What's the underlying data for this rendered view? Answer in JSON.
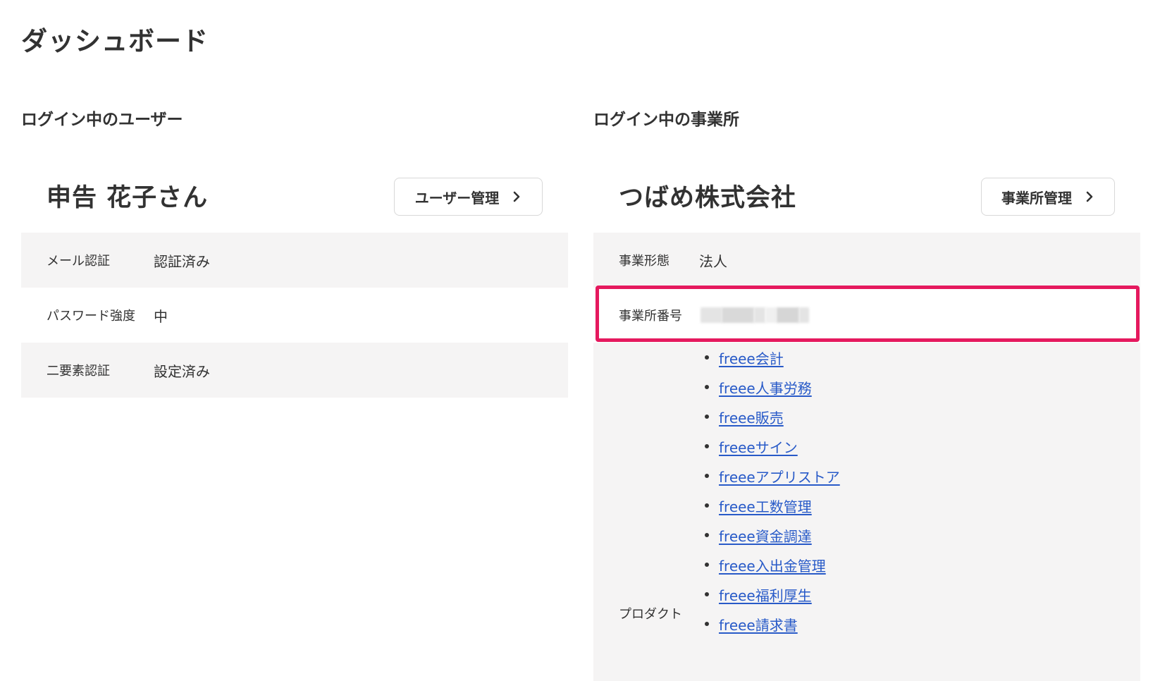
{
  "page": {
    "title": "ダッシュボード"
  },
  "user_section": {
    "title": "ログイン中のユーザー",
    "name": "申告 花子さん",
    "manage_button": "ユーザー管理",
    "rows": [
      {
        "label": "メール認証",
        "value": "認証済み"
      },
      {
        "label": "パスワード強度",
        "value": "中"
      },
      {
        "label": "二要素認証",
        "value": "設定済み"
      }
    ]
  },
  "office_section": {
    "title": "ログイン中の事業所",
    "name": "つばめ株式会社",
    "manage_button": "事業所管理",
    "business_type": {
      "label": "事業形態",
      "value": "法人"
    },
    "office_number": {
      "label": "事業所番号"
    },
    "products": {
      "label": "プロダクト",
      "items": [
        "freee会計",
        "freee人事労務",
        "freee販売",
        "freeeサイン",
        "freeeアプリストア",
        "freee工数管理",
        "freee資金調達",
        "freee入出金管理",
        "freee福利厚生",
        "freee請求書"
      ]
    }
  },
  "colors": {
    "highlight": "#e5195e",
    "link": "#285ac8",
    "row_bg": "#f5f4f4"
  },
  "icons": {
    "button_chevron": "chevron-right-icon"
  }
}
